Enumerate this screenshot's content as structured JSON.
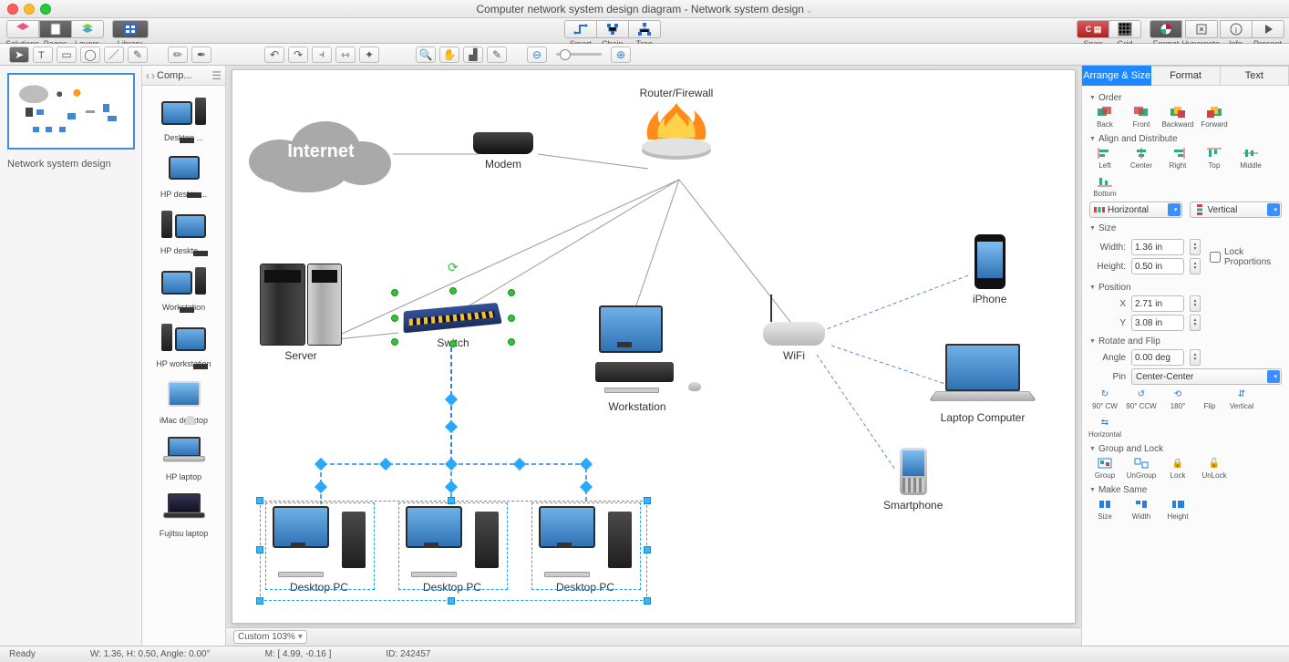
{
  "window_title": "Computer network system design diagram - Network system design",
  "toolbar": {
    "solutions": "Solutions",
    "pages": "Pages",
    "layers": "Layers",
    "library": "Library",
    "smart": "Smart",
    "chain": "Chain",
    "tree": "Tree",
    "snap": "Snap",
    "grid": "Grid",
    "format": "Format",
    "hypernote": "Hypernote",
    "info": "Info",
    "present": "Present"
  },
  "page_panel": {
    "current_page_name": "Network system design"
  },
  "library": {
    "crumb": "Comp...",
    "items": [
      {
        "label": "Desktop ..."
      },
      {
        "label": "HP deskto ..."
      },
      {
        "label": "HP deskto ..."
      },
      {
        "label": "Workstation"
      },
      {
        "label": "HP workstation"
      },
      {
        "label": "iMac desktop"
      },
      {
        "label": "HP laptop"
      },
      {
        "label": "Fujitsu laptop"
      }
    ]
  },
  "diagram": {
    "internet": "Internet",
    "modem": "Modem",
    "router_firewall": "Router/Firewall",
    "server": "Server",
    "switch": "Switch",
    "workstation": "Workstation",
    "wifi": "WiFi",
    "iphone": "iPhone",
    "laptop": "Laptop Computer",
    "smartphone": "Smartphone",
    "desktop_pc": "Desktop PC"
  },
  "zoom_label": "Custom 103%",
  "inspector": {
    "tabs": {
      "arrange": "Arrange & Size",
      "format": "Format",
      "text": "Text"
    },
    "sections": {
      "order": "Order",
      "align": "Align and Distribute",
      "size": "Size",
      "position": "Position",
      "rotate": "Rotate and Flip",
      "group": "Group and Lock",
      "same": "Make Same"
    },
    "order_btns": {
      "back": "Back",
      "front": "Front",
      "backward": "Backward",
      "forward": "Forward"
    },
    "align_btns": {
      "left": "Left",
      "center": "Center",
      "right": "Right",
      "top": "Top",
      "middle": "Middle",
      "bottom": "Bottom"
    },
    "distribute": {
      "horizontal": "Horizontal",
      "vertical": "Vertical"
    },
    "size": {
      "width_label": "Width:",
      "width_value": "1.36 in",
      "height_label": "Height:",
      "height_value": "0.50 in",
      "lock": "Lock Proportions"
    },
    "position": {
      "x_label": "X",
      "x_value": "2.71 in",
      "y_label": "Y",
      "y_value": "3.08 in"
    },
    "rotate": {
      "angle_label": "Angle",
      "angle_value": "0.00 deg",
      "pin_label": "Pin",
      "pin_value": "Center-Center",
      "cw": "90° CW",
      "ccw": "90° CCW",
      "a180": "180°",
      "flip": "Flip",
      "flipv": "Vertical",
      "fliph": "Horizontal"
    },
    "group": {
      "group": "Group",
      "ungroup": "UnGroup",
      "lock": "Lock",
      "unlock": "UnLock"
    },
    "same": {
      "size": "Size",
      "width": "Width",
      "height": "Height"
    }
  },
  "status": {
    "ready": "Ready",
    "dims": "W: 1.36,  H: 0.50,  Angle: 0.00°",
    "mouse": "M: [ 4.99, -0.16 ]",
    "id": "ID: 242457"
  }
}
